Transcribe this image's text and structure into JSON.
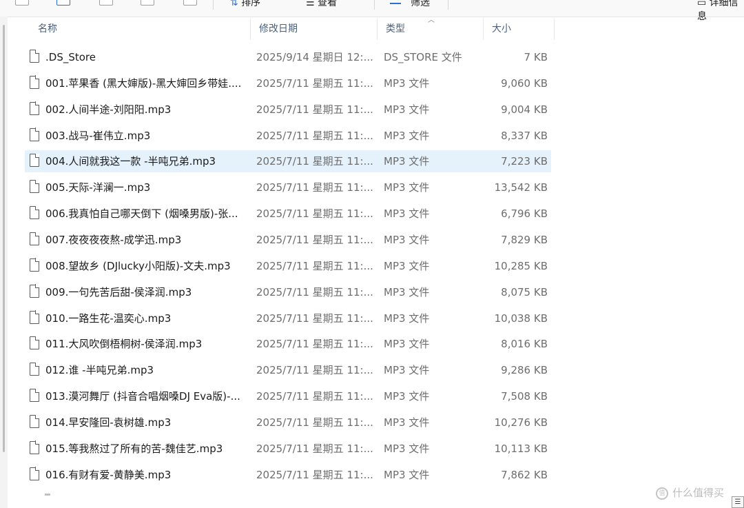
{
  "toolbar": {
    "sort_label": "排序",
    "view_label": "查看",
    "filter_label": "筛选",
    "details_label": "详细信息"
  },
  "columns": {
    "name": "名称",
    "modified": "修改日期",
    "type": "类型",
    "size": "大小"
  },
  "files": [
    {
      "name": ".DS_Store",
      "modified": "2025/9/14 星期日 12:...",
      "type": "DS_STORE 文件",
      "size": "7 KB"
    },
    {
      "name": "001.苹果香 (黑大婶版)-黑大婶回乡带娃....",
      "modified": "2025/7/11 星期五 11:...",
      "type": "MP3 文件",
      "size": "9,060 KB"
    },
    {
      "name": "002.人间半途-刘阳阳.mp3",
      "modified": "2025/7/11 星期五 11:...",
      "type": "MP3 文件",
      "size": "9,004 KB"
    },
    {
      "name": "003.战马-崔伟立.mp3",
      "modified": "2025/7/11 星期五 11:...",
      "type": "MP3 文件",
      "size": "8,337 KB"
    },
    {
      "name": "004.人间就我这一款 -半吨兄弟.mp3",
      "modified": "2025/7/11 星期五 11:...",
      "type": "MP3 文件",
      "size": "7,223 KB"
    },
    {
      "name": "005.天际-洋澜一.mp3",
      "modified": "2025/7/11 星期五 11:...",
      "type": "MP3 文件",
      "size": "13,542 KB"
    },
    {
      "name": "006.我真怕自己哪天倒下 (烟嗓男版)-张...",
      "modified": "2025/7/11 星期五 11:...",
      "type": "MP3 文件",
      "size": "6,796 KB"
    },
    {
      "name": "007.夜夜夜夜熬-成学迅.mp3",
      "modified": "2025/7/11 星期五 11:...",
      "type": "MP3 文件",
      "size": "7,829 KB"
    },
    {
      "name": "008.望故乡 (DJlucky小阳版)-文夫.mp3",
      "modified": "2025/7/11 星期五 11:...",
      "type": "MP3 文件",
      "size": "10,285 KB"
    },
    {
      "name": "009.一句先苦后甜-侯泽润.mp3",
      "modified": "2025/7/11 星期五 11:...",
      "type": "MP3 文件",
      "size": "8,075 KB"
    },
    {
      "name": "010.一路生花-温奕心.mp3",
      "modified": "2025/7/11 星期五 11:...",
      "type": "MP3 文件",
      "size": "10,038 KB"
    },
    {
      "name": "011.大风吹倒梧桐树-侯泽润.mp3",
      "modified": "2025/7/11 星期五 11:...",
      "type": "MP3 文件",
      "size": "8,016 KB"
    },
    {
      "name": "012.谁 -半吨兄弟.mp3",
      "modified": "2025/7/11 星期五 11:...",
      "type": "MP3 文件",
      "size": "9,286 KB"
    },
    {
      "name": "013.漠河舞厅 (抖音合唱烟嗓DJ Eva版)-...",
      "modified": "2025/7/11 星期五 11:...",
      "type": "MP3 文件",
      "size": "7,508 KB"
    },
    {
      "name": "014.早安隆回-袁树雄.mp3",
      "modified": "2025/7/11 星期五 11:...",
      "type": "MP3 文件",
      "size": "10,276 KB"
    },
    {
      "name": "015.等我熬过了所有的苦-魏佳艺.mp3",
      "modified": "2025/7/11 星期五 11:...",
      "type": "MP3 文件",
      "size": "10,113 KB"
    },
    {
      "name": "016.有财有爱-黄静美.mp3",
      "modified": "2025/7/11 星期五 11:...",
      "type": "MP3 文件",
      "size": "7,862 KB"
    }
  ],
  "selected_index": 4,
  "watermark": "什么值得买",
  "colors": {
    "selected_row": "#e5f1fb",
    "header_text": "#4c607a",
    "accent": "#2f6fd1"
  }
}
